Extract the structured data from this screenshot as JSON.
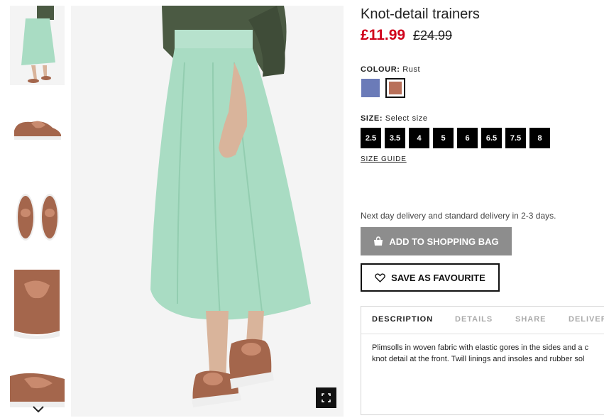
{
  "product": {
    "title": "Knot-detail trainers",
    "price_now": "£11.99",
    "price_old": "£24.99"
  },
  "colour": {
    "label": "COLOUR:",
    "selected": "Rust",
    "swatches": [
      {
        "name": "Blue",
        "color": "#6b7bb8",
        "selected": false
      },
      {
        "name": "Rust",
        "color": "#b8705a",
        "selected": true
      }
    ]
  },
  "size": {
    "label": "SIZE:",
    "prompt": "Select size",
    "options": [
      "2.5",
      "3.5",
      "4",
      "5",
      "6",
      "6.5",
      "7.5",
      "8"
    ],
    "guide_label": "SIZE GUIDE"
  },
  "delivery_text": "Next day delivery and standard delivery in 2-3 days.",
  "actions": {
    "add_to_bag": "ADD TO SHOPPING BAG",
    "favourite": "SAVE AS FAVOURITE",
    "bag_icon": "shopping-bag-icon",
    "heart_icon": "heart-icon"
  },
  "tabs": [
    {
      "label": "DESCRIPTION",
      "active": true
    },
    {
      "label": "DETAILS",
      "active": false
    },
    {
      "label": "SHARE",
      "active": false
    },
    {
      "label": "DELIVER",
      "active": false
    }
  ],
  "description": [
    "Plimsolls in woven fabric with elastic gores in the sides and a c",
    "knot detail at the front. Twill linings and insoles and rubber sol"
  ],
  "colors": {
    "price_sale": "#d0021b",
    "button_grey": "#8d8d8d",
    "skirt": "#a9dcc3",
    "jacket": "#4b5a43",
    "shoe": "#a4664c"
  },
  "icons": {
    "zoom": "fullscreen-icon",
    "thumb_down": "chevron-down-icon"
  }
}
